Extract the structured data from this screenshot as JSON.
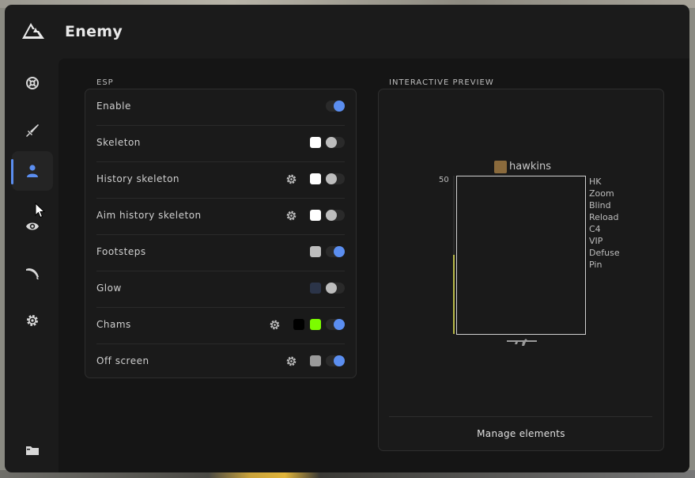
{
  "window": {
    "title": "Enemy"
  },
  "sidebar": {
    "items": [
      {
        "icon": "target-icon"
      },
      {
        "icon": "sword-icon"
      },
      {
        "icon": "user-icon",
        "active": true
      },
      {
        "icon": "eye-icon"
      },
      {
        "icon": "knife-icon"
      },
      {
        "icon": "gear-icon"
      },
      {
        "icon": "folder-icon"
      }
    ]
  },
  "esp": {
    "section_label": "ESP",
    "rows": [
      {
        "label": "Enable",
        "toggle": true
      },
      {
        "label": "Skeleton",
        "toggle": false,
        "color": "#ffffff"
      },
      {
        "label": "History skeleton",
        "toggle": false,
        "color": "#ffffff",
        "settings": true
      },
      {
        "label": "Aim history skeleton",
        "toggle": false,
        "color": "#ffffff",
        "settings": true
      },
      {
        "label": "Footsteps",
        "toggle": true,
        "color": "#bdbdbd"
      },
      {
        "label": "Glow",
        "toggle": false,
        "color": "#2b3448"
      },
      {
        "label": "Chams",
        "toggle": true,
        "colors": [
          "#000000",
          "#7cfc00"
        ],
        "settings": true
      },
      {
        "label": "Off screen",
        "toggle": true,
        "color": "#9a9a9a",
        "settings": true
      }
    ]
  },
  "preview": {
    "section_label": "INTERACTIVE PREVIEW",
    "player_name": "hawkins",
    "health": "50",
    "health_fraction": 0.5,
    "flags": [
      "HK",
      "Zoom",
      "Blind",
      "Reload",
      "C4",
      "VIP",
      "Defuse",
      "Pin"
    ],
    "manage_label": "Manage elements"
  },
  "colors": {
    "accent": "#5b8ef0",
    "health": "#b8b84a"
  }
}
